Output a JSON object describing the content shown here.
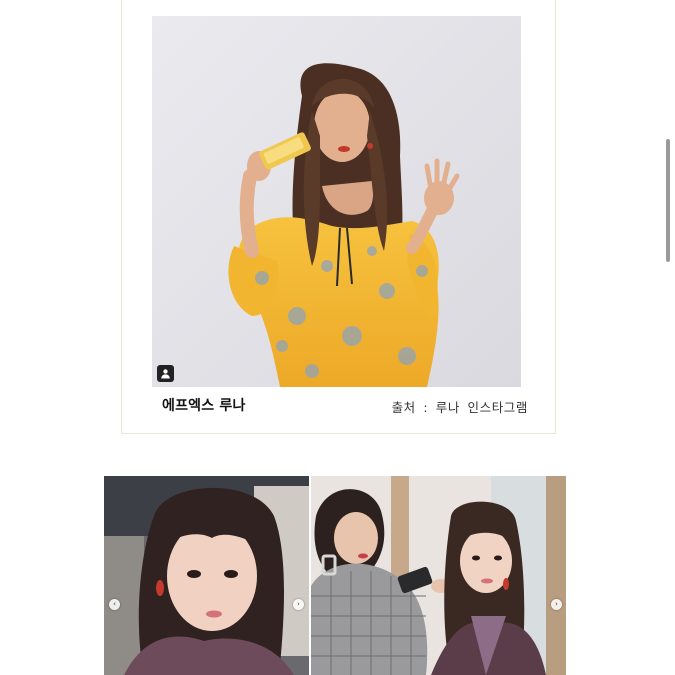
{
  "post": {
    "caption_name": "에프엑스 루나",
    "caption_source": "출처 : 루나 인스타그램"
  },
  "photo": {
    "icon": "user-tag-icon",
    "background_color": "#e6e6ea",
    "dress_color": "#f4b733"
  },
  "carousel": {
    "left_tile_icon": "chevron-left-icon",
    "left_tile_next_icon": "chevron-right-icon",
    "right_tile_next_icon": "chevron-right-icon"
  }
}
